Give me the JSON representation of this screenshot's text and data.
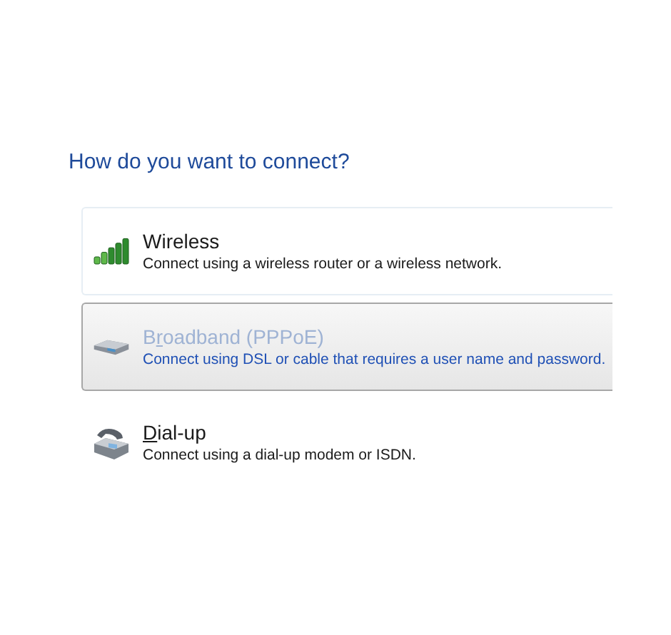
{
  "heading": "How do you want to connect?",
  "options": [
    {
      "kind": "wireless",
      "label_parts": [
        {
          "text": "Wireless",
          "underline": false
        }
      ],
      "description": "Connect using a wireless router or a wireless network.",
      "selected": false,
      "focused": true
    },
    {
      "kind": "broadband",
      "label_parts": [
        {
          "text": "B",
          "underline": false
        },
        {
          "text": "r",
          "underline": true
        },
        {
          "text": "oadband (PPPoE)",
          "underline": false
        }
      ],
      "description": "Connect using DSL or cable that requires a user name and password.",
      "selected": true,
      "focused": false
    },
    {
      "kind": "dialup",
      "label_parts": [
        {
          "text": "D",
          "underline": true
        },
        {
          "text": "ial-up",
          "underline": false
        }
      ],
      "description": "Connect using a dial-up modem or ISDN.",
      "selected": false,
      "focused": false
    }
  ]
}
